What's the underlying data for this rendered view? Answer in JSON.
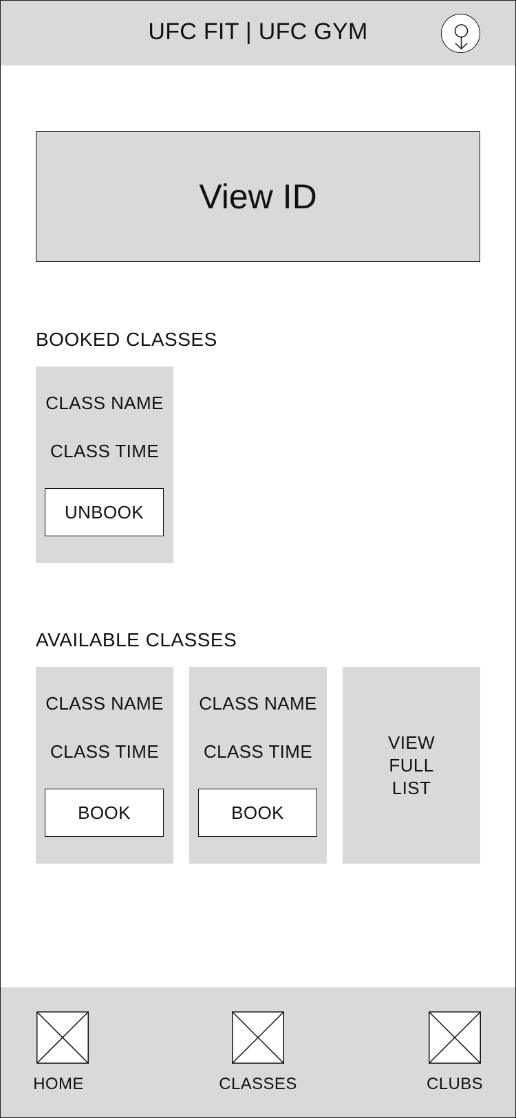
{
  "header": {
    "title": "UFC FIT | UFC GYM",
    "profile_icon": "user-profile-icon"
  },
  "view_id": {
    "label": "View ID"
  },
  "booked": {
    "title": "BOOKED CLASSES",
    "classes": [
      {
        "name": "CLASS NAME",
        "time": "CLASS TIME",
        "action": "UNBOOK"
      }
    ]
  },
  "available": {
    "title": "AVAILABLE CLASSES",
    "classes": [
      {
        "name": "CLASS NAME",
        "time": "CLASS TIME",
        "action": "BOOK"
      },
      {
        "name": "CLASS NAME",
        "time": "CLASS TIME",
        "action": "BOOK"
      }
    ],
    "view_full_list": "VIEW FULL LIST"
  },
  "nav": {
    "items": [
      {
        "label": "HOME",
        "icon": "image-placeholder-icon"
      },
      {
        "label": "CLASSES",
        "icon": "image-placeholder-icon"
      },
      {
        "label": "CLUBS",
        "icon": "image-placeholder-icon"
      }
    ]
  },
  "colors": {
    "panel": "#d9d9d9",
    "background": "#ffffff",
    "stroke": "#111111"
  }
}
